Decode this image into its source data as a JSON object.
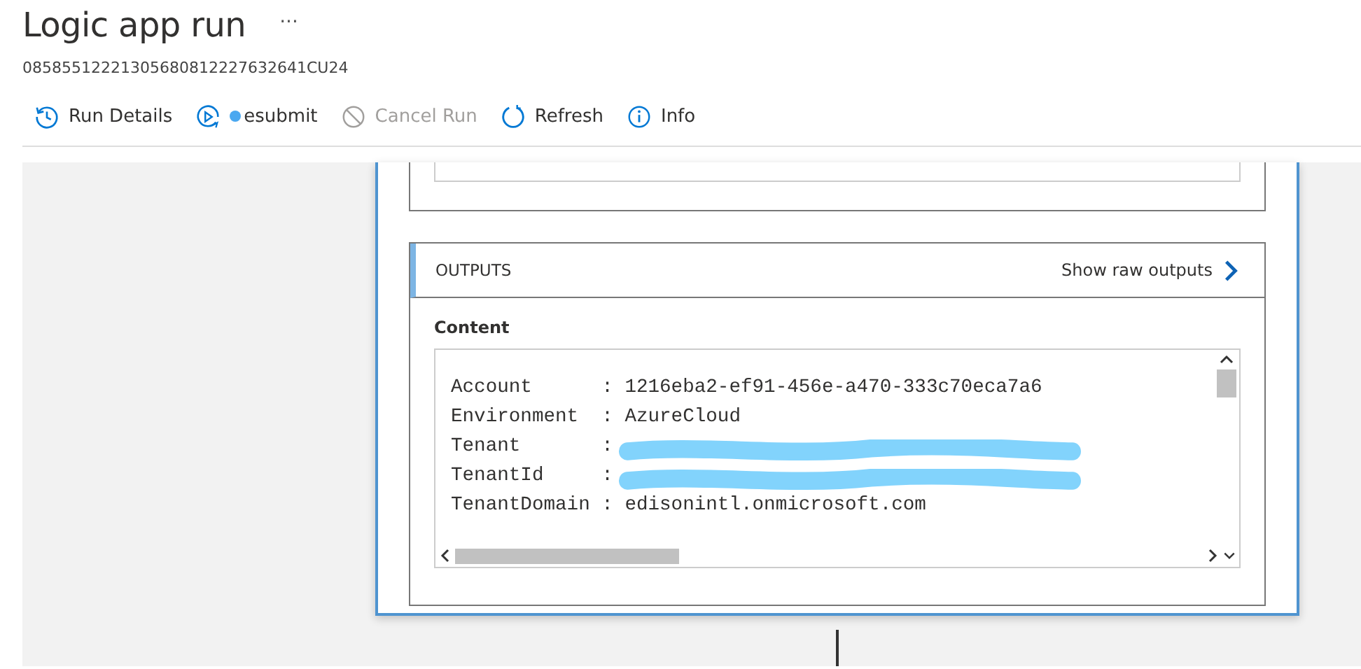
{
  "page": {
    "title": "Logic app run",
    "more": "···",
    "run_id": "08585512221305680812227632641CU24"
  },
  "toolbar": [
    {
      "kind": "details",
      "label": "Run Details",
      "disabled": false
    },
    {
      "kind": "resubmit",
      "label": "esubmit",
      "disabled": false,
      "redacted_start": true
    },
    {
      "kind": "cancel",
      "label": "Cancel Run",
      "disabled": true
    },
    {
      "kind": "refresh",
      "label": "Refresh",
      "disabled": false
    },
    {
      "kind": "info",
      "label": "Info",
      "disabled": false
    }
  ],
  "outputs": {
    "title": "OUTPUTS",
    "raw_link": "Show raw outputs",
    "content_label": "Content",
    "lines": [
      {
        "text": "Account      : 1216eba2-ef91-456e-a470-333c70eca7a6",
        "redacted": false
      },
      {
        "text": "Environment  : AzureCloud",
        "redacted": false
      },
      {
        "text": "Tenant       :",
        "redacted": true
      },
      {
        "text": "TenantId     :",
        "redacted": true
      },
      {
        "text": "TenantDomain : edisonintl.onmicrosoft.com",
        "redacted": false
      }
    ]
  }
}
